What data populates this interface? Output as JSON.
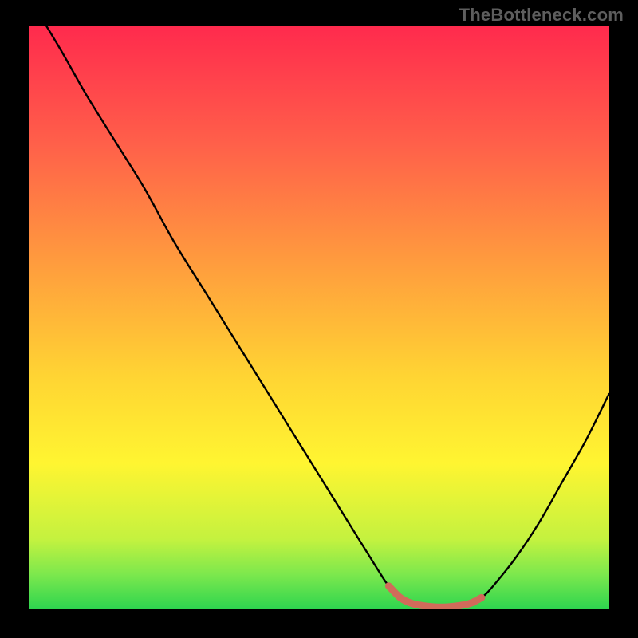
{
  "watermark": "TheBottleneck.com",
  "chart_data": {
    "type": "line",
    "title": "",
    "xlabel": "",
    "ylabel": "",
    "xlim": [
      0,
      100
    ],
    "ylim": [
      0,
      100
    ],
    "grid": false,
    "series": [
      {
        "name": "curve",
        "color": "#000000",
        "x": [
          3,
          6,
          10,
          15,
          20,
          25,
          30,
          35,
          40,
          45,
          50,
          55,
          60,
          62,
          64,
          66,
          68,
          70,
          72,
          74,
          76,
          78,
          80,
          84,
          88,
          92,
          96,
          100
        ],
        "y": [
          100,
          95,
          88,
          80,
          72,
          63,
          55,
          47,
          39,
          31,
          23,
          15,
          7,
          4,
          2,
          1,
          0.6,
          0.4,
          0.4,
          0.6,
          1,
          2,
          4,
          9,
          15,
          22,
          29,
          37
        ]
      }
    ],
    "annotations": [
      {
        "name": "highlight-band",
        "type": "segment",
        "color": "#d16b5a",
        "x": [
          62,
          64,
          66,
          68,
          70,
          72,
          74,
          76,
          78
        ],
        "y": [
          4,
          2,
          1,
          0.6,
          0.4,
          0.4,
          0.6,
          1,
          2
        ]
      }
    ],
    "background_gradient": {
      "stops": [
        {
          "offset": 0.0,
          "color": "#ff2a4d"
        },
        {
          "offset": 0.2,
          "color": "#ff5f4a"
        },
        {
          "offset": 0.4,
          "color": "#ff9a3e"
        },
        {
          "offset": 0.6,
          "color": "#ffd433"
        },
        {
          "offset": 0.75,
          "color": "#fff531"
        },
        {
          "offset": 0.88,
          "color": "#c4f23f"
        },
        {
          "offset": 0.94,
          "color": "#7de84d"
        },
        {
          "offset": 1.0,
          "color": "#2dd54f"
        }
      ]
    }
  }
}
